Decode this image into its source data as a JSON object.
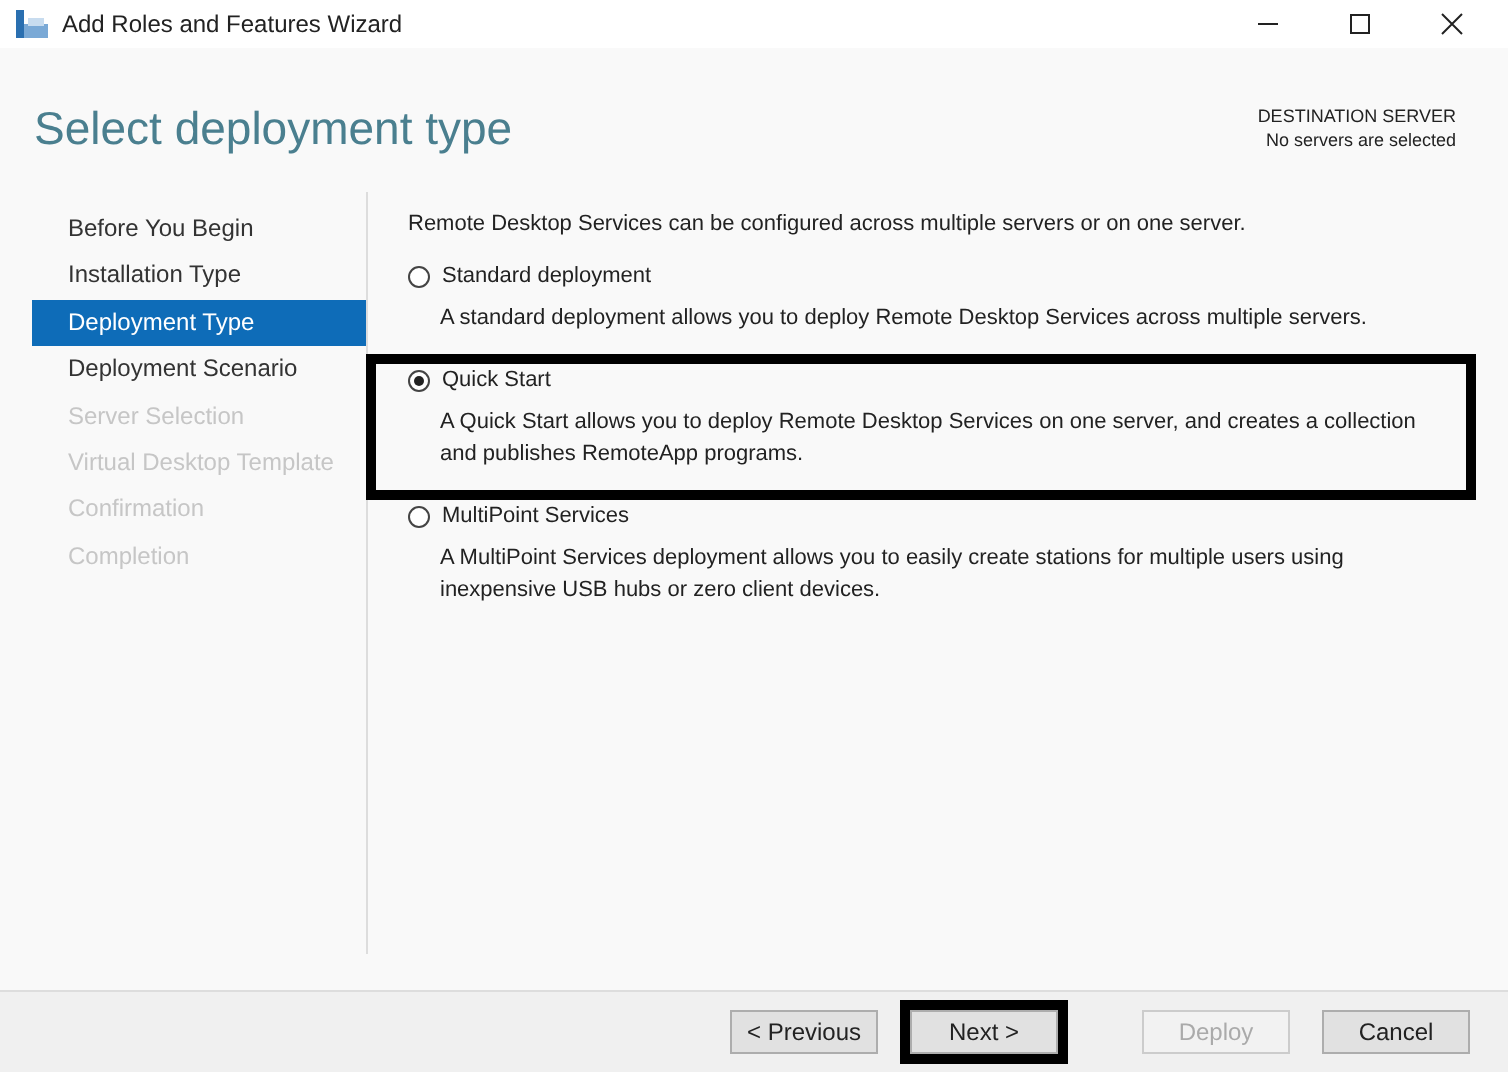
{
  "window": {
    "title": "Add Roles and Features Wizard"
  },
  "header": {
    "title": "Select deployment type",
    "destination_label": "DESTINATION SERVER",
    "destination_value": "No servers are selected"
  },
  "steps": [
    {
      "label": "Before You Begin",
      "selected": false,
      "disabled": false
    },
    {
      "label": "Installation Type",
      "selected": false,
      "disabled": false
    },
    {
      "label": "Deployment Type",
      "selected": true,
      "disabled": false
    },
    {
      "label": "Deployment Scenario",
      "selected": false,
      "disabled": false
    },
    {
      "label": "Server Selection",
      "selected": false,
      "disabled": true
    },
    {
      "label": "Virtual Desktop Template",
      "selected": false,
      "disabled": true
    },
    {
      "label": "Confirmation",
      "selected": false,
      "disabled": true
    },
    {
      "label": "Completion",
      "selected": false,
      "disabled": true
    }
  ],
  "intro": "Remote Desktop Services can be configured across multiple servers or on one server.",
  "options": [
    {
      "label": "Standard deployment",
      "description": "A standard deployment allows you to deploy Remote Desktop Services across multiple servers.",
      "selected": false,
      "highlighted": false
    },
    {
      "label": "Quick Start",
      "description": "A Quick Start allows you to deploy Remote Desktop Services on one server, and creates a collection and publishes RemoteApp programs.",
      "selected": true,
      "highlighted": true
    },
    {
      "label": "MultiPoint Services",
      "description": "A MultiPoint Services deployment allows you to easily create stations for multiple users using inexpensive USB hubs or zero client devices.",
      "selected": false,
      "highlighted": false
    }
  ],
  "buttons": [
    {
      "label": "< Previous",
      "disabled": false,
      "highlighted": false
    },
    {
      "label": "Next >",
      "disabled": false,
      "highlighted": true
    },
    {
      "label": "Deploy",
      "disabled": true,
      "highlighted": false
    },
    {
      "label": "Cancel",
      "disabled": false,
      "highlighted": false
    }
  ]
}
